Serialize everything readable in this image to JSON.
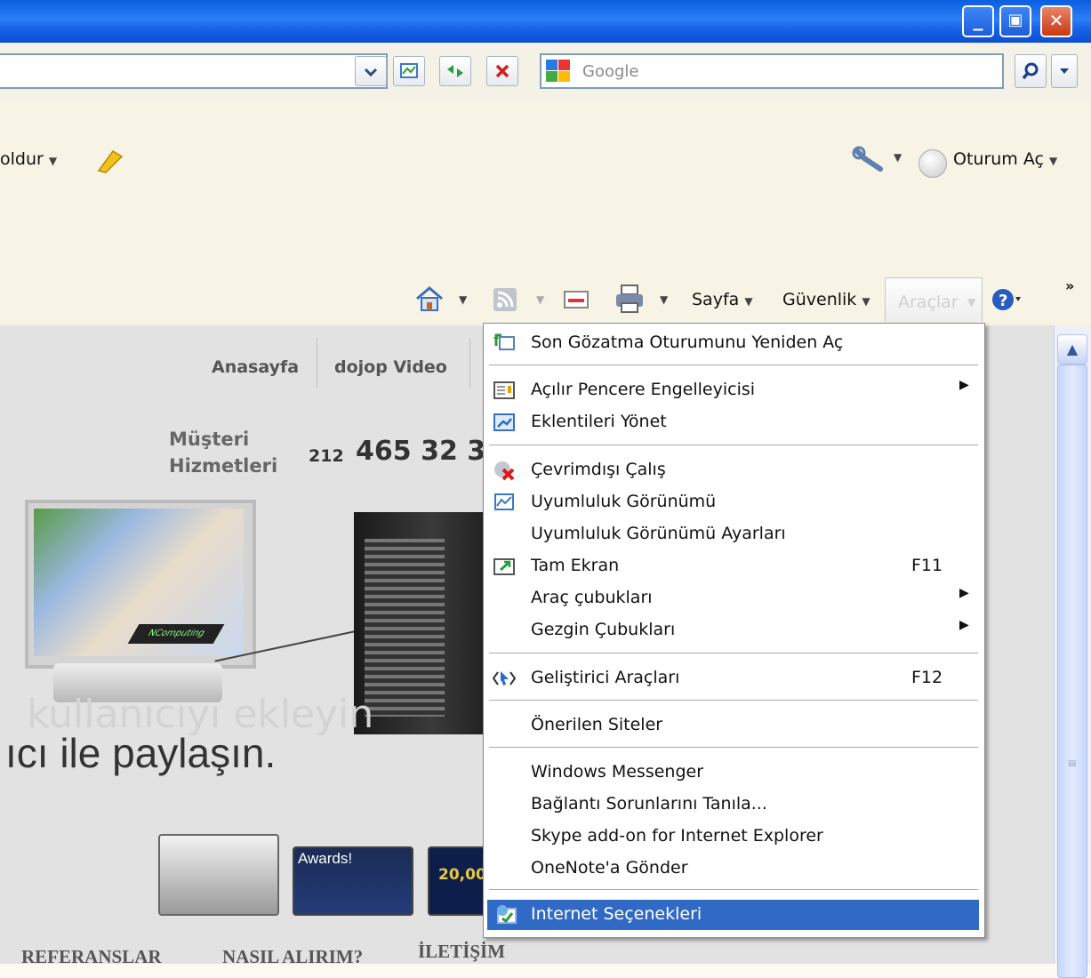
{
  "window": {
    "min": "_",
    "max": "▣",
    "close": "✕"
  },
  "search": {
    "placeholder": "Google"
  },
  "toolbar": {
    "fill_label": "oldur",
    "signin_label": "Oturum Aç",
    "page_label": "Sayfa",
    "safety_label": "Güvenlik",
    "tools_label": "Araçlar",
    "chevron": "»"
  },
  "site": {
    "nav": [
      "Anasayfa",
      "dojop Video"
    ],
    "support_line1": "Müşteri",
    "support_line2": "Hizmetleri",
    "phone_prefix": "212",
    "phone": "465 32 3",
    "watermark": "kullanıcıyı ekleyin",
    "tagline": "ıcı ile paylaşın.",
    "award_badge": "Awards!",
    "counter_badge": "20,00",
    "product_label": "NComputing",
    "bottom_nav": [
      "REFERANSLAR",
      "NASIL ALIRIM?",
      "İLETİŞİM"
    ]
  },
  "menu": {
    "items": [
      {
        "label": "Son Gözatma Oturumunu Yeniden Aç",
        "shortcut": ""
      },
      {
        "label": "Açılır Pencere Engelleyicisi",
        "submenu": true
      },
      {
        "label": "Eklentileri Yönet"
      },
      {
        "label": "Çevrimdışı Çalış"
      },
      {
        "label": "Uyumluluk Görünümü"
      },
      {
        "label": "Uyumluluk Görünümü Ayarları"
      },
      {
        "label": "Tam Ekran",
        "shortcut": "F11"
      },
      {
        "label": "Araç çubukları",
        "submenu": true
      },
      {
        "label": "Gezgin Çubukları",
        "submenu": true
      },
      {
        "label": "Geliştirici Araçları",
        "shortcut": "F12"
      },
      {
        "label": "Önerilen Siteler"
      },
      {
        "label": "Windows Messenger"
      },
      {
        "label": "Bağlantı Sorunlarını Tanıla..."
      },
      {
        "label": "Skype add-on for Internet Explorer"
      },
      {
        "label": "OneNote'a Gönder"
      },
      {
        "label": "Internet Seçenekleri",
        "highlighted": true
      }
    ],
    "submenu_arrow": "▶"
  },
  "colors": {
    "highlight": "#316ac5",
    "titlebar": "#0a5ee0"
  }
}
